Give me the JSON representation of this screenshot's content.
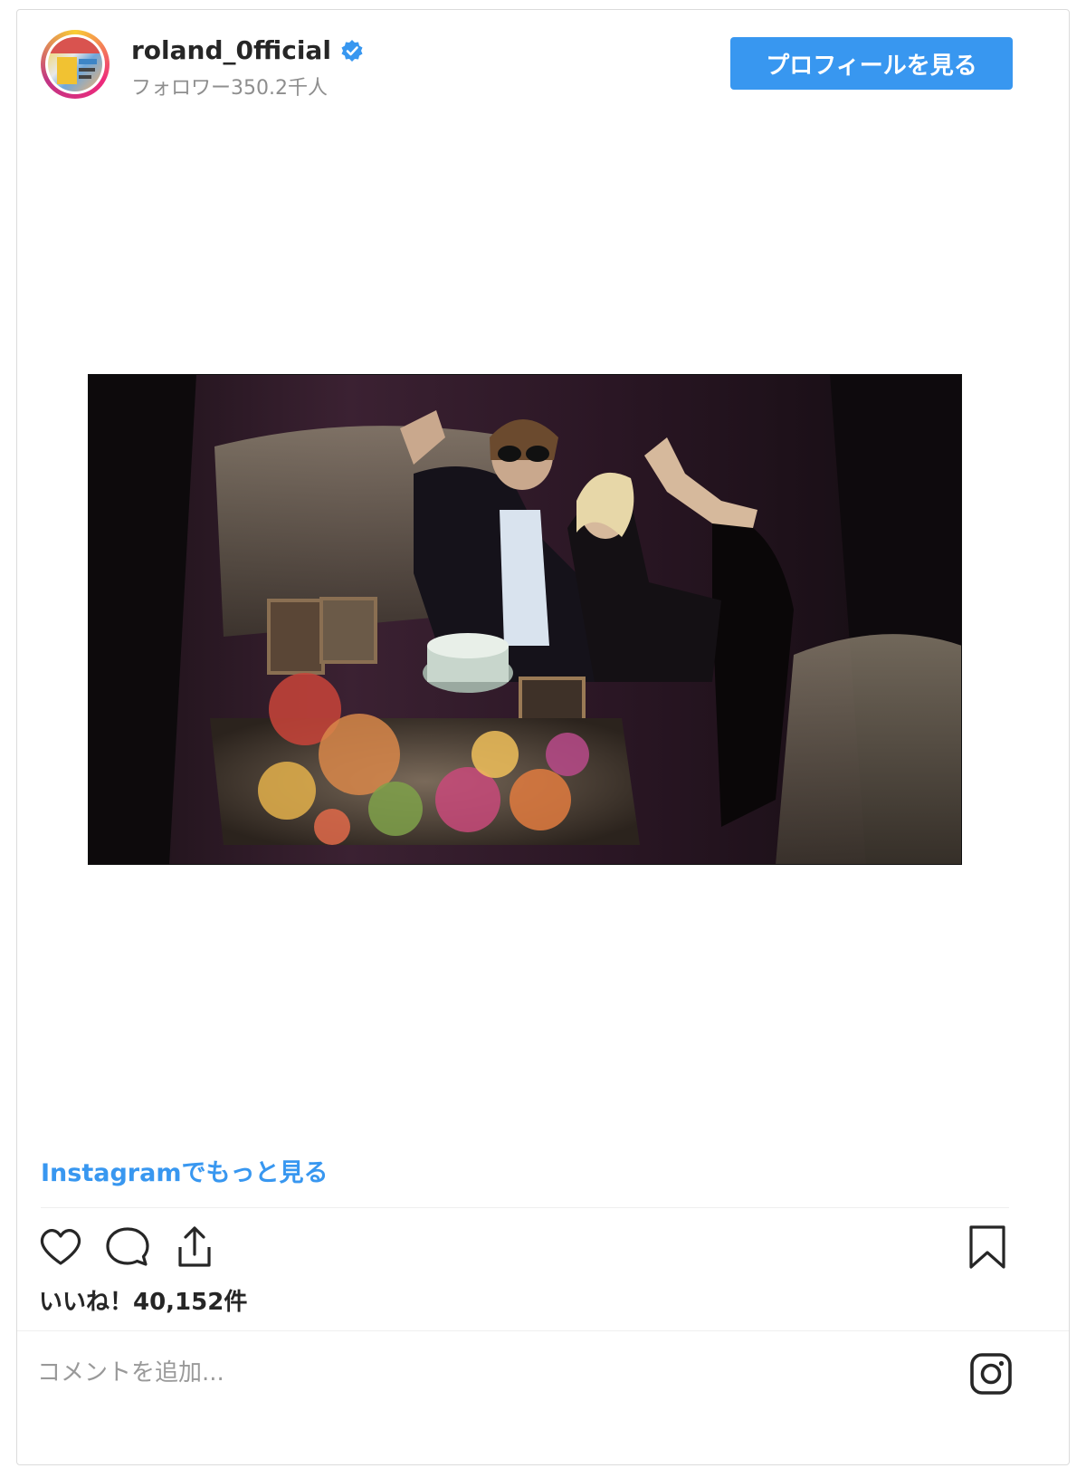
{
  "header": {
    "username": "roland_0fficial",
    "followers": "フォロワー350.2千人",
    "profile_button": "プロフィールを見る"
  },
  "post": {
    "more_link": "Instagramでもっと見る",
    "likes": "いいね！40,152件",
    "comment_placeholder": "コメントを追加..."
  },
  "icons": {
    "verified": "verified-badge-icon",
    "like": "heart-icon",
    "comment": "comment-icon",
    "share": "share-icon",
    "save": "bookmark-icon",
    "brand": "instagram-icon"
  },
  "colors": {
    "accent": "#3897f0",
    "text": "#262626",
    "muted": "#8e8e8e"
  }
}
